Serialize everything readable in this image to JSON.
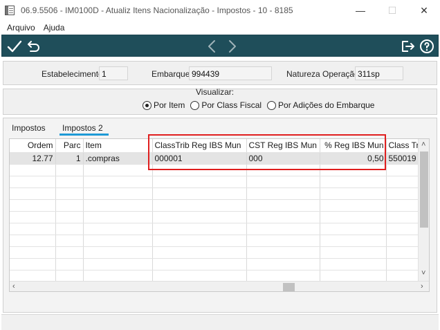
{
  "window": {
    "title": "06.9.5506 - IM0100D  -  Atualiz Itens Nacionalização - Impostos - 10 - 8185",
    "minimize": "—",
    "maximize": "☐",
    "close": "✕"
  },
  "menu": {
    "items": [
      "Arquivo",
      "Ajuda"
    ]
  },
  "toolbar": {
    "icons": [
      "check-icon",
      "undo-icon",
      "chevron-left-icon",
      "chevron-right-icon",
      "exit-icon",
      "help-icon"
    ]
  },
  "header": {
    "estabelecimento_label": "Estabelecimento:",
    "estabelecimento_value": "1",
    "embarque_label": "Embarque:",
    "embarque_value": "994439",
    "natureza_label": "Natureza Operação:",
    "natureza_value": "311sp"
  },
  "visualizar": {
    "label": "Visualizar:",
    "options": [
      "Por Item",
      "Por Class Fiscal",
      "Por Adições do Embarque"
    ],
    "selected": "Por Item"
  },
  "tabs": [
    "Impostos",
    "Impostos 2"
  ],
  "active_tab": "Impostos 2",
  "grid": {
    "columns": [
      "Ordem",
      "Parc",
      "Item",
      "ClassTrib Reg IBS Mun",
      "CST Reg IBS Mun",
      "% Reg IBS Mun",
      "Class Trib"
    ],
    "rows": [
      [
        "12.77",
        "1",
        ".compras",
        "000001",
        "000",
        "0,50",
        "550019"
      ]
    ]
  },
  "colors": {
    "toolbar_bg": "#1f4e5a",
    "tab_accent": "#1e9ad6",
    "highlight": "#e01e1e"
  }
}
